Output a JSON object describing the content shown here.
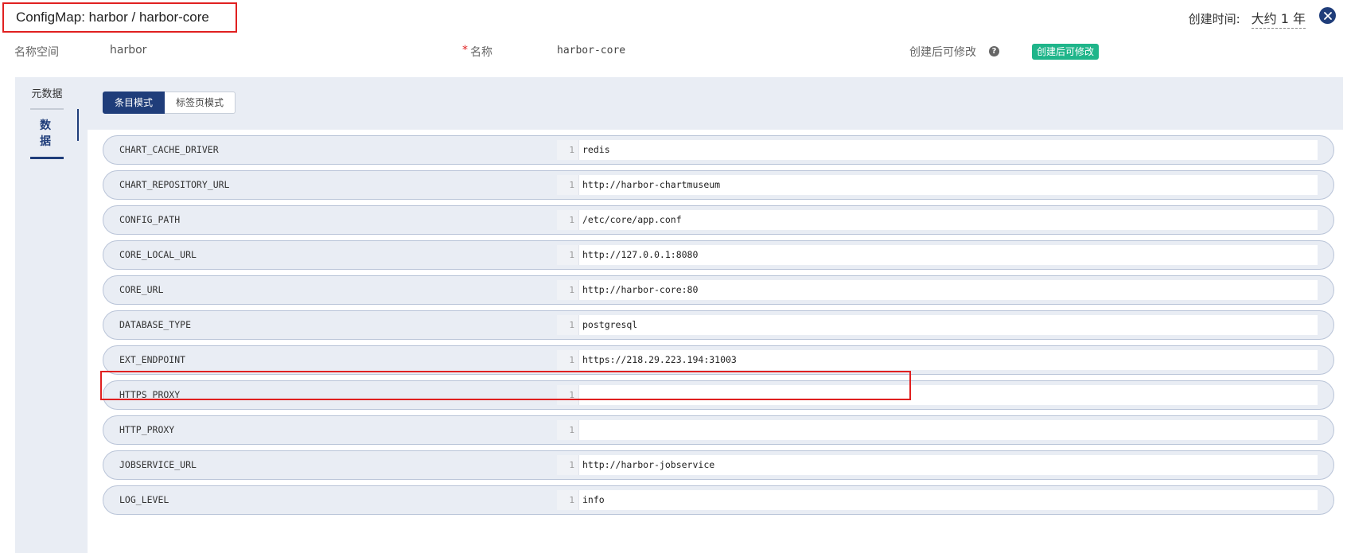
{
  "header": {
    "title": "ConfigMap: harbor / harbor-core",
    "created_label": "创建时间:",
    "created_value": "大约 1 年"
  },
  "info": {
    "namespace_label": "名称空间",
    "namespace_value": "harbor",
    "required_mark": "*",
    "name_label": "名称",
    "name_value": "harbor-core",
    "modify_label": "创建后可修改",
    "help_glyph": "?",
    "modify_badge": "创建后可修改"
  },
  "side_tabs": {
    "meta": "元数据",
    "data": "数 据"
  },
  "mode_toggle": {
    "entry": "条目模式",
    "tab": "标签页模式"
  },
  "rows": [
    {
      "key": "CHART_CACHE_DRIVER",
      "line": "1",
      "value": "redis"
    },
    {
      "key": "CHART_REPOSITORY_URL",
      "line": "1",
      "value": "http://harbor-chartmuseum"
    },
    {
      "key": "CONFIG_PATH",
      "line": "1",
      "value": "/etc/core/app.conf"
    },
    {
      "key": "CORE_LOCAL_URL",
      "line": "1",
      "value": "http://127.0.0.1:8080"
    },
    {
      "key": "CORE_URL",
      "line": "1",
      "value": "http://harbor-core:80"
    },
    {
      "key": "DATABASE_TYPE",
      "line": "1",
      "value": "postgresql"
    },
    {
      "key": "EXT_ENDPOINT",
      "line": "1",
      "value": "https://218.29.223.194:31003"
    },
    {
      "key": "HTTPS_PROXY",
      "line": "1",
      "value": ""
    },
    {
      "key": "HTTP_PROXY",
      "line": "1",
      "value": ""
    },
    {
      "key": "JOBSERVICE_URL",
      "line": "1",
      "value": "http://harbor-jobservice"
    },
    {
      "key": "LOG_LEVEL",
      "line": "1",
      "value": "info"
    }
  ],
  "colors": {
    "accent": "#1f3d7a",
    "badge": "#1fb58a",
    "highlight": "#e02020"
  },
  "icons": {
    "close": "close-icon",
    "help": "help-icon"
  }
}
